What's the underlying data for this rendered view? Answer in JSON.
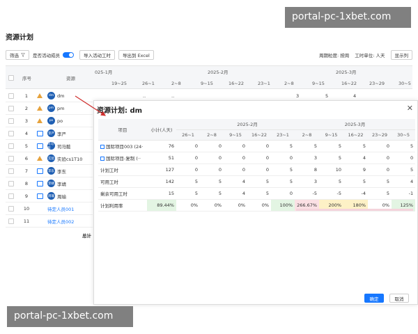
{
  "page_title": "资源计划",
  "watermark": "portal-pc-1xbet.com",
  "toolbar": {
    "filter": "筛选",
    "filter_icon": "funnel-icon",
    "toggle_label": "是否活动成员",
    "import_btn": "导入活动工时",
    "export_btn": "导出到 Excel",
    "granularity": "周期粒度: 按周",
    "unit": "工时单位: 人天",
    "show_cols_btn": "显示列"
  },
  "grid": {
    "col_index": "序号",
    "col_resource": "资源",
    "month_left": "025-1月",
    "month_mid": "2025-2月",
    "month_right": "2025-3月",
    "weeks": [
      "19~25",
      "26~1",
      "2~8",
      "9~15",
      "16~22",
      "23~1",
      "2~8",
      "9~15",
      "16~22",
      "23~29",
      "30~5"
    ],
    "row1_values": [
      "..",
      "..",
      "3",
      "5",
      "4"
    ],
    "rows": [
      {
        "idx": "1",
        "icon": "warning-icon",
        "avatar": "dm",
        "name": "dm"
      },
      {
        "idx": "2",
        "icon": "warning-icon",
        "avatar": "pm",
        "name": "pm"
      },
      {
        "idx": "3",
        "icon": "warning-icon",
        "avatar": "po",
        "name": "po"
      },
      {
        "idx": "4",
        "icon": "calendar-icon",
        "avatar": "李严",
        "name": "李严"
      },
      {
        "idx": "5",
        "icon": "calendar-icon",
        "avatar": "司马懿",
        "name": "司马懿"
      },
      {
        "idx": "6",
        "icon": "warning-icon",
        "avatar": "实验",
        "name": "实验cs1T10"
      },
      {
        "idx": "7",
        "icon": "calendar-icon",
        "avatar": "李东",
        "name": "李东"
      },
      {
        "idx": "8",
        "icon": "calendar-icon",
        "avatar": "李靖",
        "name": "李靖"
      },
      {
        "idx": "9",
        "icon": "calendar-icon",
        "avatar": "周瑜",
        "name": "周瑜"
      },
      {
        "idx": "10",
        "name": "待定人员001"
      },
      {
        "idx": "11",
        "name": "待定人员002"
      }
    ],
    "total": "总计"
  },
  "modal": {
    "title": "资源计划: dm",
    "close_icon": "close-icon",
    "expand_icon": "expand-icon",
    "head": {
      "project": "项目",
      "subtotal": "小计(人天)",
      "month_feb": "2025-2月",
      "month_mar": "2025-3月",
      "weeks": [
        "26~1",
        "2~8",
        "9~15",
        "16~22",
        "23~1",
        "2~8",
        "9~15",
        "16~22",
        "23~29",
        "30~5"
      ]
    },
    "rows": [
      {
        "label": "国际项目003 (24·",
        "icon": "project-icon",
        "subtotal": "76",
        "values": [
          "0",
          "0",
          "0",
          "0",
          "5",
          "5",
          "5",
          "5",
          "0",
          "5"
        ]
      },
      {
        "label": "国际项目-复制 (··",
        "icon": "project-icon",
        "subtotal": "51",
        "values": [
          "0",
          "0",
          "0",
          "0",
          "0",
          "3",
          "5",
          "4",
          "0",
          "0"
        ]
      },
      {
        "label": "计划工时",
        "subtotal": "127",
        "values": [
          "0",
          "0",
          "0",
          "0",
          "5",
          "8",
          "10",
          "9",
          "0",
          "5"
        ]
      },
      {
        "label": "可用工时",
        "subtotal": "142",
        "values": [
          "5",
          "5",
          "4",
          "5",
          "5",
          "3",
          "5",
          "5",
          "5",
          "4"
        ]
      },
      {
        "label": "剩余可用工时",
        "subtotal": "15",
        "values": [
          "5",
          "5",
          "4",
          "5",
          "0",
          "-5",
          "-5",
          "-4",
          "5",
          "-1"
        ]
      },
      {
        "label": "计划利用率",
        "subtotal": "89.44%",
        "values": [
          "0%",
          "0%",
          "0%",
          "0%",
          "100%",
          "266.67%",
          "200%",
          "180%",
          "0%",
          "125%"
        ]
      }
    ],
    "ok_btn": "确定",
    "cancel_btn": "取消"
  }
}
